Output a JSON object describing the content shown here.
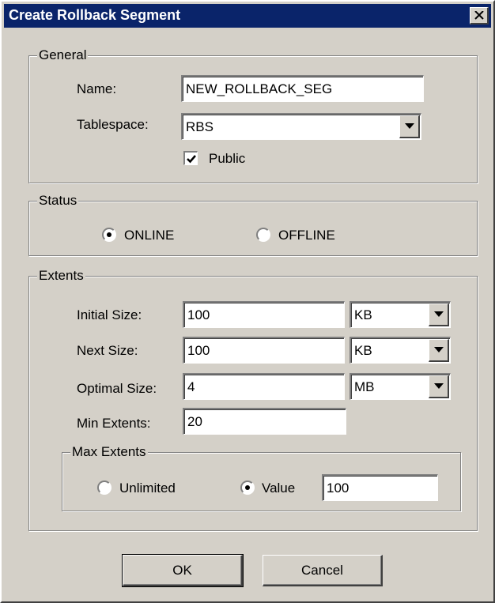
{
  "window": {
    "title": "Create Rollback Segment",
    "close_icon": "close-x-icon"
  },
  "general": {
    "legend": "General",
    "name_label": "Name:",
    "name_value": "NEW_ROLLBACK_SEG",
    "tablespace_label": "Tablespace:",
    "tablespace_value": "RBS",
    "public_label": "Public",
    "public_checked": true
  },
  "status": {
    "legend": "Status",
    "options": [
      {
        "label": "ONLINE",
        "selected": true
      },
      {
        "label": "OFFLINE",
        "selected": false
      }
    ]
  },
  "extents": {
    "legend": "Extents",
    "initial_size_label": "Initial Size:",
    "initial_size_value": "100",
    "initial_size_unit": "KB",
    "next_size_label": "Next Size:",
    "next_size_value": "100",
    "next_size_unit": "KB",
    "optimal_size_label": "Optimal Size:",
    "optimal_size_value": "4",
    "optimal_size_unit": "MB",
    "min_extents_label": "Min Extents:",
    "min_extents_value": "20",
    "max_extents": {
      "legend": "Max Extents",
      "unlimited_label": "Unlimited",
      "unlimited_selected": false,
      "value_label": "Value",
      "value_selected": true,
      "value": "100"
    }
  },
  "buttons": {
    "ok_label": "OK",
    "cancel_label": "Cancel"
  },
  "colors": {
    "titlebar": "#0a246a",
    "dialog_face": "#d4d0c8"
  }
}
